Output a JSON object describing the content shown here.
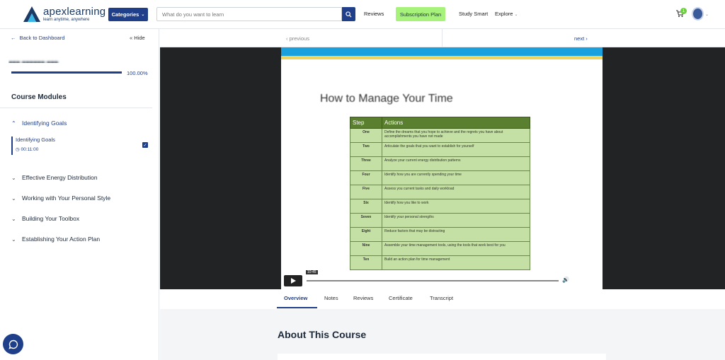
{
  "header": {
    "logo_name": "apexlearning",
    "logo_tagline": "learn anytime, anywhere",
    "categories_label": "Categories",
    "search_placeholder": "What do you want to learn",
    "reviews_label": "Reviews",
    "subscription_label": "Subscription Plan",
    "study_smart_label": "Study Smart",
    "explore_label": "Explore",
    "cart_count": "1"
  },
  "sidebar": {
    "back_label": "Back to Dashboard",
    "hide_label": "Hide",
    "progress_value": 1.0,
    "progress_text": "100.00%",
    "modules_heading": "Course Modules",
    "modules": [
      {
        "label": "Identifying Goals",
        "expanded": true
      },
      {
        "label": "Effective Energy Distribution",
        "expanded": false
      },
      {
        "label": "Working with Your Personal Style",
        "expanded": false
      },
      {
        "label": "Building Your Toolbox",
        "expanded": false
      },
      {
        "label": "Establishing Your Action Plan",
        "expanded": false
      }
    ],
    "lesson": {
      "title": "Identifying Goals",
      "duration": "00:11:00",
      "completed": true
    }
  },
  "pager": {
    "prev_label": "previous",
    "next_label": "next"
  },
  "video": {
    "slide_title": "How to Manage Your Time",
    "table_headers": [
      "Step",
      "Actions"
    ],
    "rows": [
      [
        "One",
        "Define the dreams that you hope to achieve and the regrets you have about accomplishments you have not made"
      ],
      [
        "Two",
        "Articulate the goals that you want to establish for yourself"
      ],
      [
        "Three",
        "Analyze your current energy distribution patterns"
      ],
      [
        "Four",
        "Identify how you are currently spending your time"
      ],
      [
        "Five",
        "Assess you current tasks and daily workload"
      ],
      [
        "Six",
        "Identify how you like to work"
      ],
      [
        "Seven",
        "Identify your personal strengths"
      ],
      [
        "Eight",
        "Reduce factors that may be distracting"
      ],
      [
        "Nine",
        "Assemble your time management tools, using the tools that work best for you"
      ],
      [
        "Ten",
        "Build an action plan for time management"
      ]
    ],
    "time_label": "10:45"
  },
  "tabs": [
    "Overview",
    "Notes",
    "Reviews",
    "Certificate",
    "Transcript"
  ],
  "about_heading": "About This Course"
}
